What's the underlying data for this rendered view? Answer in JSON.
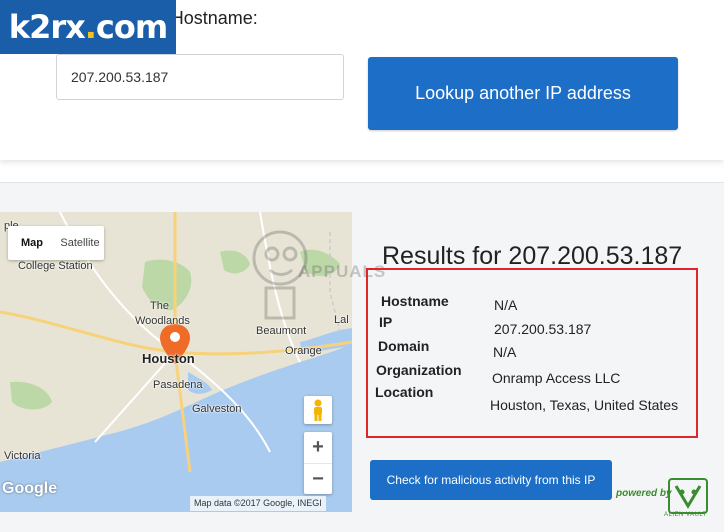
{
  "watermark": {
    "brand_left": "k2rx",
    "brand_dot": ".",
    "brand_right": "com"
  },
  "lookup": {
    "field_label": "IP Address or Hostname:",
    "input_value": "207.200.53.187",
    "button_label": "Lookup another IP address"
  },
  "map": {
    "toggle": {
      "map": "Map",
      "satellite": "Satellite"
    },
    "labels": {
      "college_station": "College Station",
      "the_woodlands_1": "The",
      "the_woodlands_2": "Woodlands",
      "houston": "Houston",
      "pasadena": "Pasadena",
      "galveston": "Galveston",
      "beaumont": "Beaumont",
      "orange": "Orange",
      "lake": "Lal",
      "victoria": "Victoria",
      "temple": "ple"
    },
    "zoom_in": "+",
    "zoom_out": "−",
    "google": "Google",
    "attribution": "Map data ©2017 Google, INEGI"
  },
  "results": {
    "title": "Results for 207.200.53.187",
    "rows": [
      {
        "key": "Hostname",
        "value": "N/A"
      },
      {
        "key": "IP",
        "value": "207.200.53.187"
      },
      {
        "key": "Domain",
        "value": "N/A"
      },
      {
        "key": "Organization",
        "value": "Onramp Access LLC"
      },
      {
        "key": "Location",
        "value": "Houston, Texas, United States"
      }
    ]
  },
  "malicious": {
    "button_label": "Check for malicious activity from this IP",
    "powered_by": "powered by",
    "vendor": "ALIEN VAULT"
  },
  "appuals": "APPUALS",
  "colors": {
    "button_blue": "#1c6ec6",
    "highlight_red": "#e0252b",
    "map_water": "#a9cbef",
    "map_land": "#e8e4d5",
    "pin": "#ef6c28"
  }
}
